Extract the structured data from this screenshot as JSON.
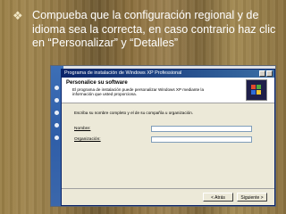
{
  "slide": {
    "bullet_text": "Compueba que la configuración regional y de idioma sea la correcta, en caso contrario haz clic en “Personalizar” y “Detalles”"
  },
  "setup_window": {
    "title": "Programa de instalación de Windows XP Professional",
    "header_title": "Personalice su software",
    "header_description": "El programa de instalación puede personalizar Windows XP mediante la información que usted proporciona.",
    "intro": "Escriba su nombre completo y el de su compañía u organización.",
    "fields": [
      {
        "label": "Nombre:",
        "value": ""
      },
      {
        "label": "Organización:",
        "value": ""
      }
    ],
    "buttons": {
      "back": "< Atrás",
      "next": "Siguiente >"
    }
  },
  "colors": {
    "background": "#8b6f3d",
    "bullet_text": "#ffffff",
    "titlebar": "#0a246a"
  }
}
